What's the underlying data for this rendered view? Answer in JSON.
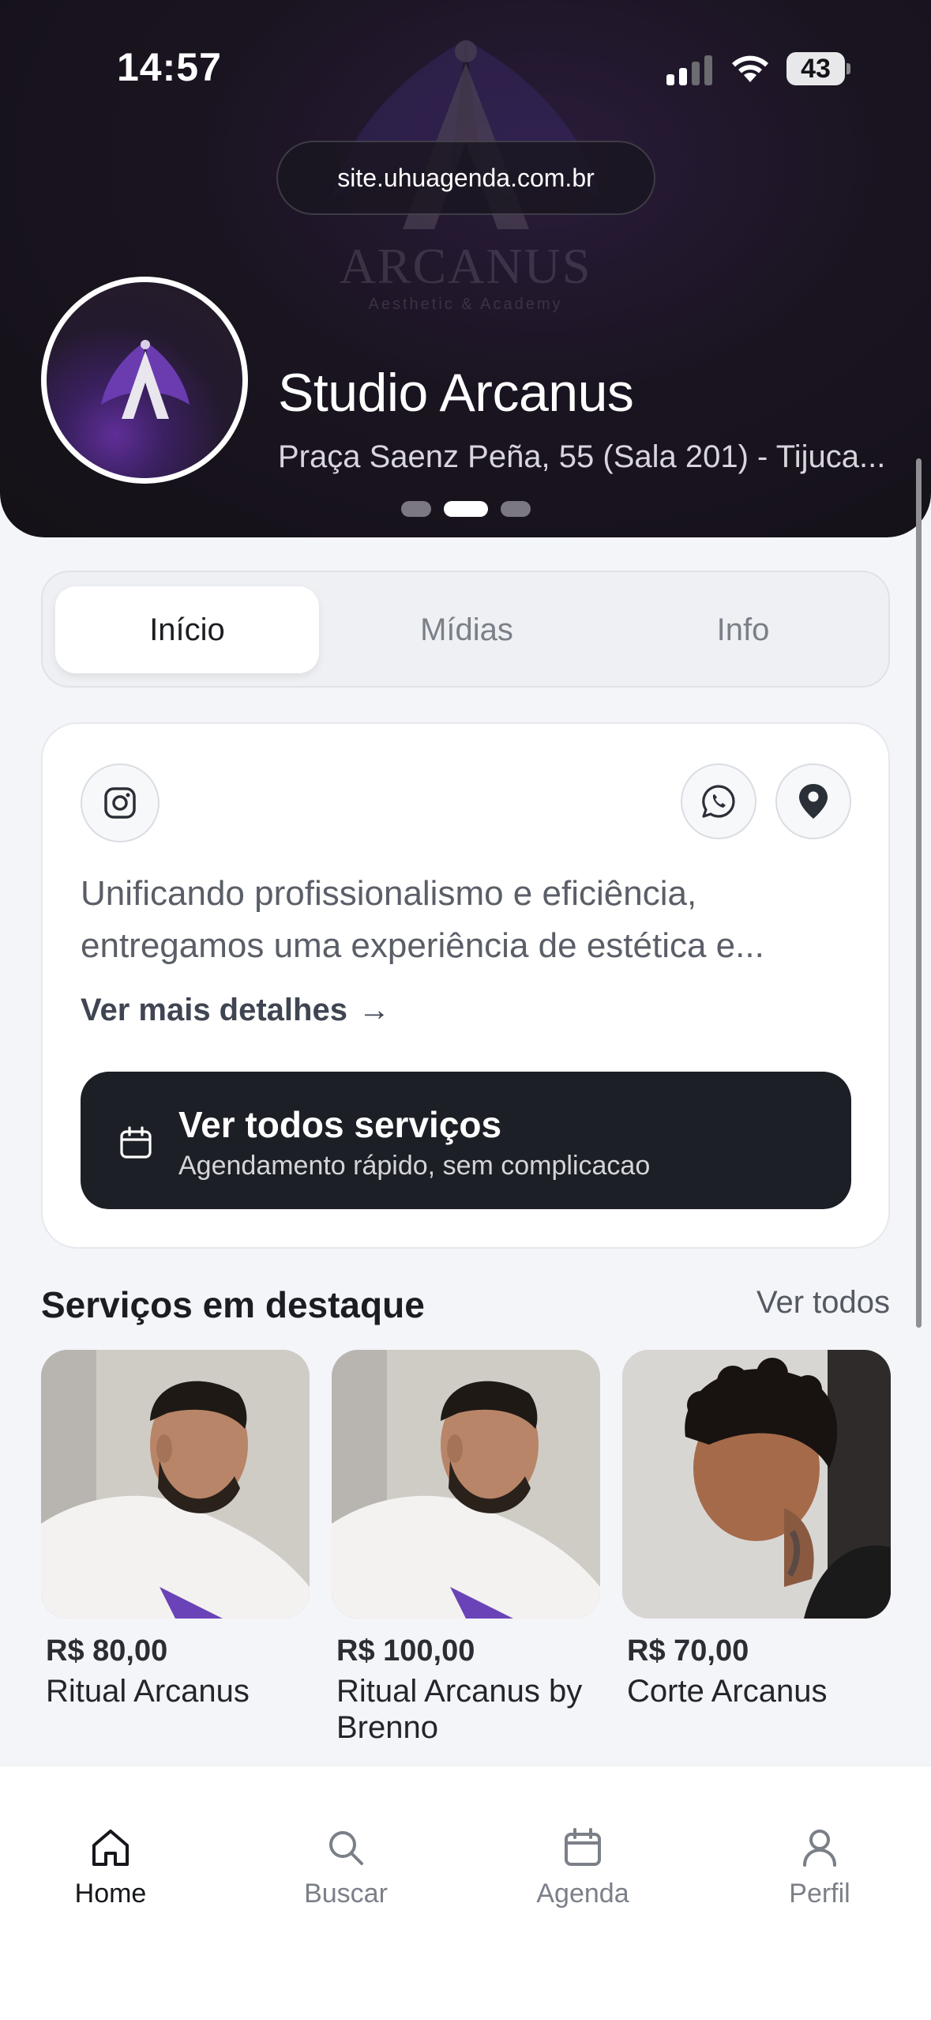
{
  "status_bar": {
    "time": "14:57",
    "battery": "43"
  },
  "browser": {
    "url": "site.uhuagenda.com.br"
  },
  "hero": {
    "brand_watermark": "ARCANUS",
    "brand_watermark_sub": "Aesthetic & Academy",
    "studio_name": "Studio Arcanus",
    "address": "Praça Saenz Peña, 55 (Sala 201) - Tijuca...",
    "carousel_pages": 3,
    "carousel_active": 2
  },
  "tabs": [
    {
      "label": "Início",
      "active": true
    },
    {
      "label": "Mídias",
      "active": false
    },
    {
      "label": "Info",
      "active": false
    }
  ],
  "info": {
    "icons": [
      "instagram-icon",
      "whatsapp-icon",
      "location-pin-icon"
    ],
    "description": "Unificando profissionalismo e eficiência, entregamos uma experiência de estética e...",
    "more_link": "Ver mais detalhes",
    "more_arrow": "→",
    "services_button": {
      "title": "Ver todos serviços",
      "subtitle": "Agendamento rápido, sem complicacao",
      "icon": "calendar-icon"
    }
  },
  "featured": {
    "title": "Serviços em destaque",
    "see_all": "Ver todos",
    "items": [
      {
        "price": "R$ 80,00",
        "name": "Ritual Arcanus"
      },
      {
        "price": "R$ 100,00",
        "name": "Ritual Arcanus by Brenno"
      },
      {
        "price": "R$ 70,00",
        "name": "Corte Arcanus"
      }
    ]
  },
  "bottom_nav": [
    {
      "label": "Home",
      "icon": "home-icon",
      "active": true
    },
    {
      "label": "Buscar",
      "icon": "search-icon",
      "active": false
    },
    {
      "label": "Agenda",
      "icon": "calendar-icon",
      "active": false
    },
    {
      "label": "Perfil",
      "icon": "user-icon",
      "active": false
    }
  ],
  "colors": {
    "hero_bg": "#141117",
    "accent_purple": "#5f2e98",
    "button_dark": "#1c1f25",
    "page_bg": "#f3f5f8"
  }
}
